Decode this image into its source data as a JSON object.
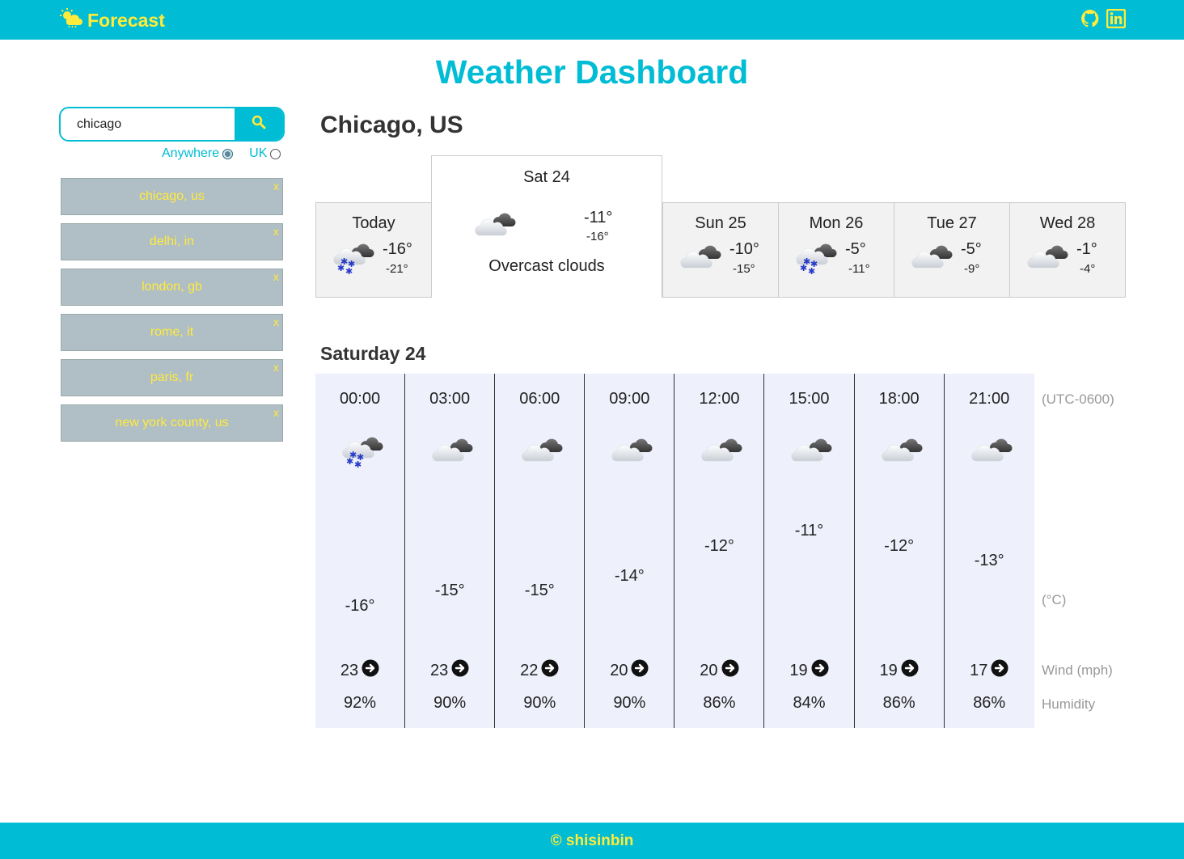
{
  "header": {
    "brand": "Forecast",
    "icons": [
      "github-icon",
      "linkedin-icon"
    ]
  },
  "title": "Weather Dashboard",
  "search": {
    "value": "chicago",
    "icon": "search-icon",
    "options": [
      {
        "label": "Anywhere",
        "checked": true
      },
      {
        "label": "UK",
        "checked": false
      }
    ]
  },
  "saved": [
    {
      "label": "chicago, us",
      "remove": "x"
    },
    {
      "label": "delhi, in",
      "remove": "x"
    },
    {
      "label": "london, gb",
      "remove": "x"
    },
    {
      "label": "rome, it",
      "remove": "x"
    },
    {
      "label": "paris, fr",
      "remove": "x"
    },
    {
      "label": "new york county, us",
      "remove": "x"
    }
  ],
  "city": "Chicago, US",
  "days": [
    {
      "name": "Today",
      "icon": "snow-cloud-icon",
      "hi": "-16°",
      "lo": "-21°"
    },
    {
      "name": "Sat 24",
      "icon": "overcast-cloud-icon",
      "hi": "-11°",
      "lo": "-16°",
      "desc": "Overcast clouds",
      "selected": true
    },
    {
      "name": "Sun 25",
      "icon": "overcast-cloud-icon",
      "hi": "-10°",
      "lo": "-15°"
    },
    {
      "name": "Mon 26",
      "icon": "snow-cloud-icon",
      "hi": "-5°",
      "lo": "-11°"
    },
    {
      "name": "Tue 27",
      "icon": "overcast-cloud-icon",
      "hi": "-5°",
      "lo": "-9°"
    },
    {
      "name": "Wed 28",
      "icon": "overcast-cloud-icon",
      "hi": "-1°",
      "lo": "-4°"
    }
  ],
  "hourly": {
    "title": "Saturday 24",
    "timezone": "(UTC-0600)",
    "temp_unit": "(°C)",
    "wind_label": "Wind (mph)",
    "humidity_label": "Humidity",
    "hours": [
      {
        "time": "00:00",
        "icon": "snow-cloud-icon",
        "temp": -16,
        "temp_label": "-16°",
        "wind": "23",
        "humidity": "92%"
      },
      {
        "time": "03:00",
        "icon": "overcast-cloud-icon",
        "temp": -15,
        "temp_label": "-15°",
        "wind": "23",
        "humidity": "90%"
      },
      {
        "time": "06:00",
        "icon": "overcast-cloud-icon",
        "temp": -15,
        "temp_label": "-15°",
        "wind": "22",
        "humidity": "90%"
      },
      {
        "time": "09:00",
        "icon": "overcast-cloud-icon",
        "temp": -14,
        "temp_label": "-14°",
        "wind": "20",
        "humidity": "90%"
      },
      {
        "time": "12:00",
        "icon": "overcast-cloud-icon",
        "temp": -12,
        "temp_label": "-12°",
        "wind": "20",
        "humidity": "86%"
      },
      {
        "time": "15:00",
        "icon": "overcast-cloud-icon",
        "temp": -11,
        "temp_label": "-11°",
        "wind": "19",
        "humidity": "84%"
      },
      {
        "time": "18:00",
        "icon": "overcast-cloud-icon",
        "temp": -12,
        "temp_label": "-12°",
        "wind": "19",
        "humidity": "86%"
      },
      {
        "time": "21:00",
        "icon": "overcast-cloud-icon",
        "temp": -13,
        "temp_label": "-13°",
        "wind": "17",
        "humidity": "86%"
      }
    ]
  },
  "footer": "© shisinbin",
  "colors": {
    "accent": "#00bcd4",
    "brand_text": "#ffeb3b",
    "saved_bg": "#b0bec5",
    "hourly_bg": "#eef0fb"
  }
}
